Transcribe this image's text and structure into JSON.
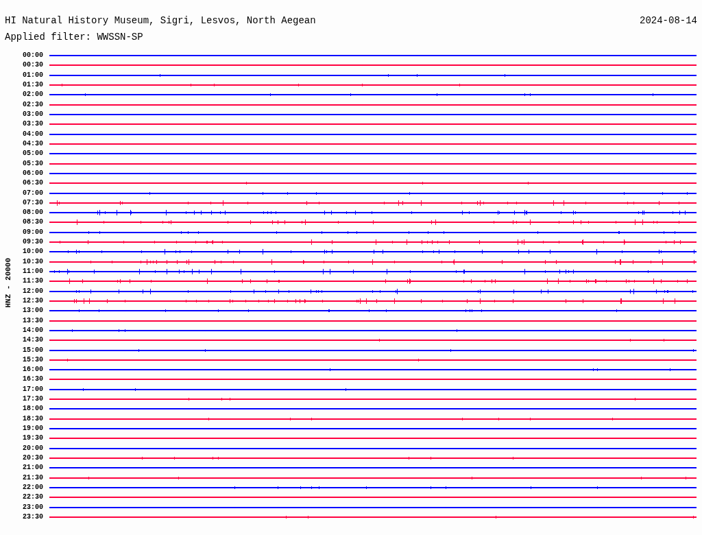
{
  "header": {
    "station": "HI Natural History Museum, Sigri, Lesvos, North Aegean",
    "date": "2024-08-14",
    "filter": "Applied filter: WWSSN-SP"
  },
  "axis_label": "HNZ - 20000",
  "traces": [
    {
      "time": "00:00",
      "color": "#0000ff"
    },
    {
      "time": "00:30",
      "color": "#ff0040"
    },
    {
      "time": "01:00",
      "color": "#0000ff"
    },
    {
      "time": "01:30",
      "color": "#ff0040"
    },
    {
      "time": "02:00",
      "color": "#0000ff"
    },
    {
      "time": "02:30",
      "color": "#ff0040"
    },
    {
      "time": "03:00",
      "color": "#0000ff"
    },
    {
      "time": "03:30",
      "color": "#ff0040"
    },
    {
      "time": "04:00",
      "color": "#0000ff"
    },
    {
      "time": "04:30",
      "color": "#ff0040"
    },
    {
      "time": "05:00",
      "color": "#0000ff"
    },
    {
      "time": "05:30",
      "color": "#ff0040"
    },
    {
      "time": "06:00",
      "color": "#0000ff"
    },
    {
      "time": "06:30",
      "color": "#ff0040"
    },
    {
      "time": "07:00",
      "color": "#0000ff"
    },
    {
      "time": "07:30",
      "color": "#ff0040"
    },
    {
      "time": "08:00",
      "color": "#0000ff"
    },
    {
      "time": "08:30",
      "color": "#ff0040"
    },
    {
      "time": "09:00",
      "color": "#0000ff"
    },
    {
      "time": "09:30",
      "color": "#ff0040"
    },
    {
      "time": "10:00",
      "color": "#0000ff"
    },
    {
      "time": "10:30",
      "color": "#ff0040"
    },
    {
      "time": "11:00",
      "color": "#0000ff"
    },
    {
      "time": "11:30",
      "color": "#ff0040"
    },
    {
      "time": "12:00",
      "color": "#0000ff"
    },
    {
      "time": "12:30",
      "color": "#ff0040"
    },
    {
      "time": "13:00",
      "color": "#0000ff"
    },
    {
      "time": "13:30",
      "color": "#ff0040"
    },
    {
      "time": "14:00",
      "color": "#0000ff"
    },
    {
      "time": "14:30",
      "color": "#ff0040"
    },
    {
      "time": "15:00",
      "color": "#0000ff"
    },
    {
      "time": "15:30",
      "color": "#ff0040"
    },
    {
      "time": "16:00",
      "color": "#0000ff"
    },
    {
      "time": "16:30",
      "color": "#ff0040"
    },
    {
      "time": "17:00",
      "color": "#0000ff"
    },
    {
      "time": "17:30",
      "color": "#ff0040"
    },
    {
      "time": "18:00",
      "color": "#0000ff"
    },
    {
      "time": "18:30",
      "color": "#ff0040"
    },
    {
      "time": "19:00",
      "color": "#0000ff"
    },
    {
      "time": "19:30",
      "color": "#ff0040"
    },
    {
      "time": "20:00",
      "color": "#0000ff"
    },
    {
      "time": "20:30",
      "color": "#ff0040"
    },
    {
      "time": "21:00",
      "color": "#0000ff"
    },
    {
      "time": "21:30",
      "color": "#ff0040"
    },
    {
      "time": "22:00",
      "color": "#0000ff"
    },
    {
      "time": "22:30",
      "color": "#ff0040"
    },
    {
      "time": "23:00",
      "color": "#0000ff"
    },
    {
      "time": "23:30",
      "color": "#ff0040"
    }
  ]
}
